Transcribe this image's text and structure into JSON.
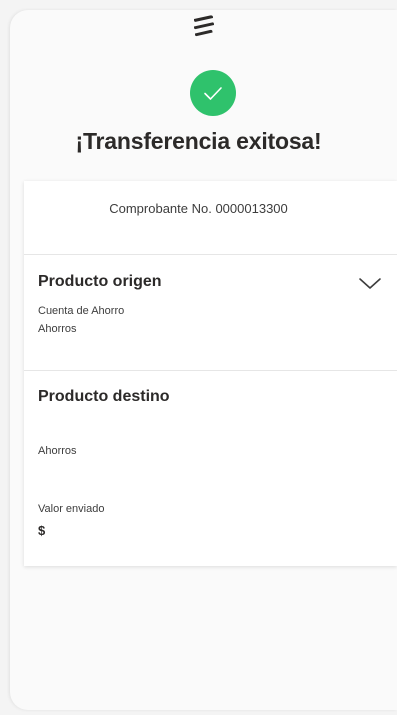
{
  "colors": {
    "success": "#2fc26c",
    "text": "#2c2a29",
    "card": "#ffffff"
  },
  "header": {
    "logo_icon": "bank-logo-icon",
    "status_icon": "checkmark-icon",
    "title": "¡Transferencia exitosa!"
  },
  "receipt": {
    "label": "Comprobante No. 0000013300"
  },
  "origin": {
    "title": "Producto origen",
    "account_name": "Cuenta de Ahorro",
    "account_type": "Ahorros",
    "toggle_icon": "chevron-down-icon"
  },
  "destination": {
    "title": "Producto destino",
    "account_type": "Ahorros"
  },
  "amount": {
    "label": "Valor enviado",
    "value": "$"
  }
}
